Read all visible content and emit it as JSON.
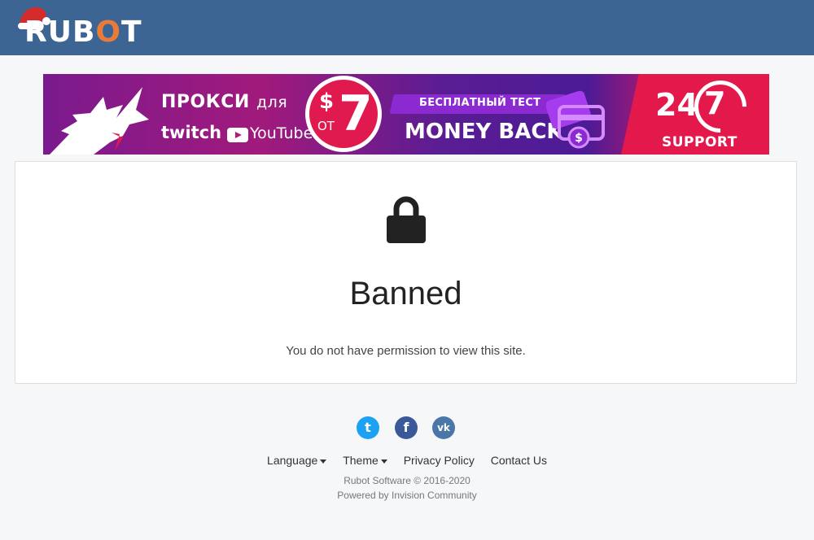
{
  "header": {
    "logo_text_part1": "RUB",
    "logo_text_o": "O",
    "logo_text_part2": "T",
    "background_color": "#3d6594"
  },
  "banner": {
    "proxy_text": "ПРОКСИ",
    "proxy_suffix": "для",
    "twitch": "twitch",
    "youtube": "YouTube",
    "price_currency": "$",
    "price_from": "ОТ",
    "price_value": "7",
    "free_test": "БЕСПЛАТНЫЙ ТЕСТ",
    "money_back": "MONEY BACK",
    "support_24": "24",
    "support_7": "7",
    "support_label": "SUPPORT"
  },
  "main": {
    "icon": "lock-icon",
    "title": "Banned",
    "message": "You do not have permission to view this site."
  },
  "footer": {
    "social": [
      {
        "name": "twitter-icon",
        "glyph": "t",
        "color": "#1da1f2"
      },
      {
        "name": "facebook-icon",
        "glyph": "f",
        "color": "#3b5998"
      },
      {
        "name": "vk-icon",
        "glyph": "vk",
        "color": "#4a76a8"
      }
    ],
    "links": {
      "language": "Language",
      "theme": "Theme",
      "privacy": "Privacy Policy",
      "contact": "Contact Us"
    },
    "copyright": "Rubot Software © 2016-2020",
    "powered_by": "Powered by Invision Community"
  }
}
